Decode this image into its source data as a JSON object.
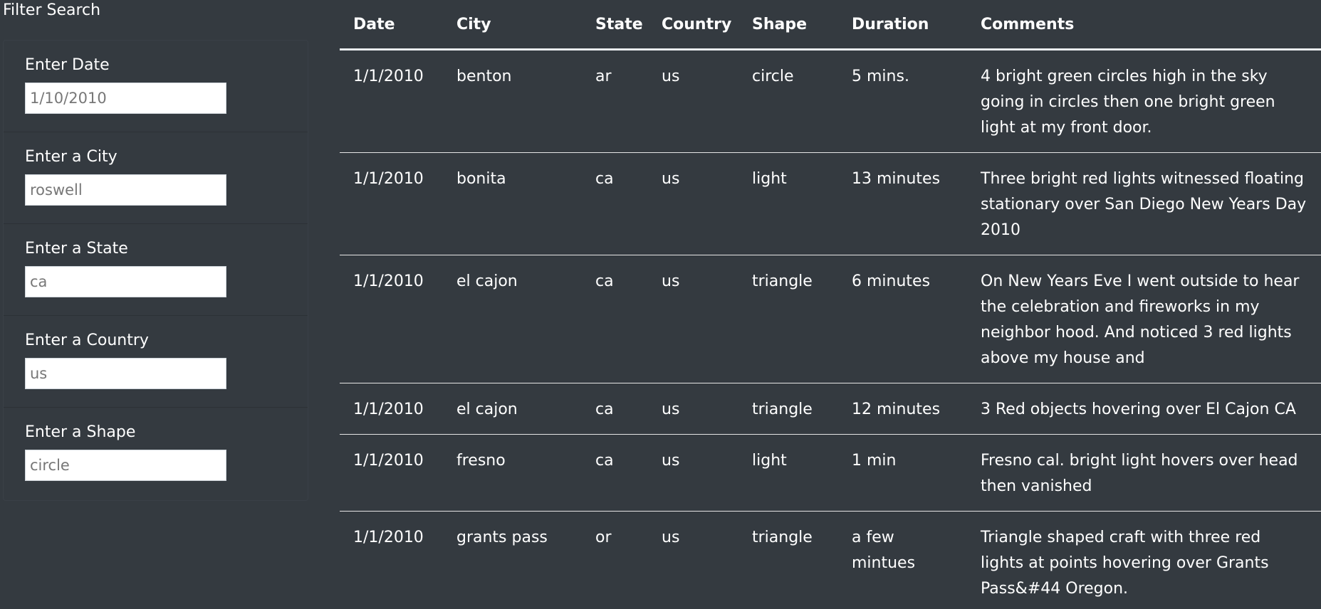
{
  "filter": {
    "title": "Filter Search",
    "fields": [
      {
        "label": "Enter Date",
        "placeholder": "1/10/2010",
        "value": ""
      },
      {
        "label": "Enter a City",
        "placeholder": "roswell",
        "value": ""
      },
      {
        "label": "Enter a State",
        "placeholder": "ca",
        "value": ""
      },
      {
        "label": "Enter a Country",
        "placeholder": "us",
        "value": ""
      },
      {
        "label": "Enter a Shape",
        "placeholder": "circle",
        "value": ""
      }
    ]
  },
  "table": {
    "headers": [
      "Date",
      "City",
      "State",
      "Country",
      "Shape",
      "Duration",
      "Comments"
    ],
    "rows": [
      [
        "1/1/2010",
        "benton",
        "ar",
        "us",
        "circle",
        "5 mins.",
        "4 bright green circles high in the sky going in circles then one bright green light at my front door."
      ],
      [
        "1/1/2010",
        "bonita",
        "ca",
        "us",
        "light",
        "13 minutes",
        "Three bright red lights witnessed floating stationary over San Diego New Years Day 2010"
      ],
      [
        "1/1/2010",
        "el cajon",
        "ca",
        "us",
        "triangle",
        "6 minutes",
        "On New Years Eve I went outside to hear the celebration and fireworks in my neighbor hood. And noticed 3 red lights above my house and"
      ],
      [
        "1/1/2010",
        "el cajon",
        "ca",
        "us",
        "triangle",
        "12 minutes",
        "3 Red objects hovering over El Cajon CA"
      ],
      [
        "1/1/2010",
        "fresno",
        "ca",
        "us",
        "light",
        "1 min",
        "Fresno cal. bright light hovers over head then vanished"
      ],
      [
        "1/1/2010",
        "grants pass",
        "or",
        "us",
        "triangle",
        "a few mintues",
        "Triangle shaped craft with three red lights at points hovering over Grants Pass&#44 Oregon."
      ]
    ]
  }
}
